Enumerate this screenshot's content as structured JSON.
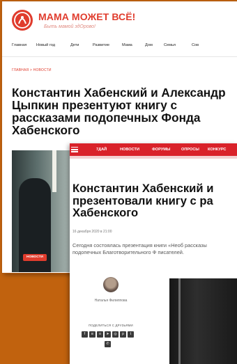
{
  "mama": {
    "brand": "МАМА МОЖЕТ ВСЁ!",
    "tagline": "Быть мамой здОрово!",
    "nav": [
      "Главная",
      "Новый год",
      "Дети",
      "Развитие",
      "Мама",
      "Дом",
      "Семья",
      "Сов"
    ],
    "breadcrumb": "ГЛАВНАЯ > НОВОСТИ",
    "title": "Константин Хабенский и Александр Цыпкин презентуют книгу с рассказами подопечных Фонда Хабенского",
    "badge": "НОВОСТИ"
  },
  "sevendays": {
    "topnav": [
      "7ДАЙ",
      "НОВОСТИ",
      "ФОРУМЫ",
      "ОПРОСЫ",
      "КОНКУРС"
    ],
    "title": "Константин Хабенский и презентовали книгу с ра Хабенского",
    "date": "16 декабря 2020 в 21:00",
    "lead": "Сегодня состоялась презентация книги «Необ рассказы подопечных Благотворительного Ф писателей.",
    "author": "Наталья Филиппова",
    "share_label": "ПОДЕЛИТЬСЯ С ДРУЗЬЯМИ",
    "social_icons": [
      "facebook-icon",
      "vk-icon",
      "ok-icon",
      "telegram-icon",
      "instagram-icon",
      "pinterest-icon",
      "twitter-icon",
      "viber-icon"
    ]
  },
  "colors": {
    "accent": "#e03c2d",
    "seven_red": "#d9222a",
    "frame": "#c1620e"
  }
}
